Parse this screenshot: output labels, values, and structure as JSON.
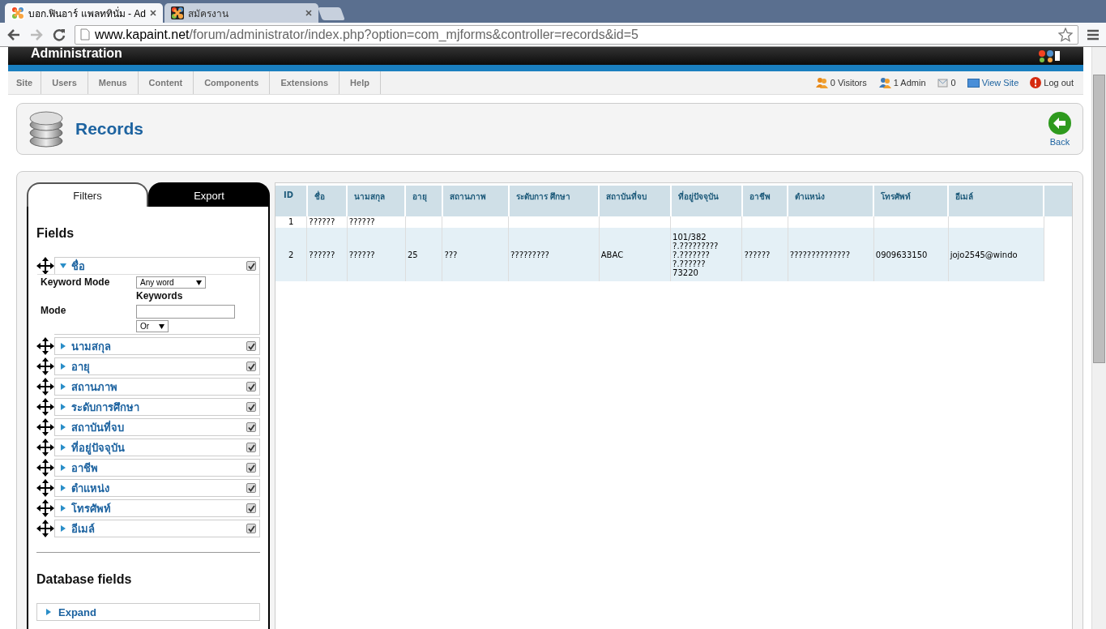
{
  "browser": {
    "tabs": [
      {
        "title": "บอก.ฟินอาร์ แพลททินั่ม - Ad",
        "selected": true
      },
      {
        "title": "สมัครงาน",
        "selected": false
      }
    ],
    "url": {
      "host": "www.kapaint.net",
      "path": "/forum/administrator/index.php?option=com_mjforms&controller=records&id=5"
    }
  },
  "header": {
    "title": "Administration"
  },
  "menu": [
    "Site",
    "Users",
    "Menus",
    "Content",
    "Components",
    "Extensions",
    "Help"
  ],
  "status": [
    {
      "kind": "visitors",
      "text": "0 Visitors"
    },
    {
      "kind": "admins",
      "text": "1 Admin"
    },
    {
      "kind": "messages",
      "text": "0"
    },
    {
      "kind": "view-site",
      "text": "View Site"
    },
    {
      "kind": "logout",
      "text": "Log out"
    }
  ],
  "toolbar": {
    "title": "Records",
    "back": "Back"
  },
  "filters": {
    "tabs": [
      {
        "label": "Filters",
        "selected": true
      },
      {
        "label": "Export",
        "selected": false
      }
    ],
    "fields_heading": "Fields",
    "fields": [
      {
        "label": "ชื่อ",
        "expanded": true,
        "checked": true
      },
      {
        "label": "นามสกุล",
        "expanded": false,
        "checked": true
      },
      {
        "label": "อายุ",
        "expanded": false,
        "checked": true
      },
      {
        "label": "สถานภาพ",
        "expanded": false,
        "checked": true
      },
      {
        "label": "ระดับการศึกษา",
        "expanded": false,
        "checked": true
      },
      {
        "label": "สถาบันที่จบ",
        "expanded": false,
        "checked": true
      },
      {
        "label": "ที่อยู่ปัจจุบัน",
        "expanded": false,
        "checked": true
      },
      {
        "label": "อาชีพ",
        "expanded": false,
        "checked": true
      },
      {
        "label": "ตำแหน่ง",
        "expanded": false,
        "checked": true
      },
      {
        "label": "โทรศัพท์",
        "expanded": false,
        "checked": true
      },
      {
        "label": "อีเมล์",
        "expanded": false,
        "checked": true
      }
    ],
    "detail": {
      "keyword_mode_label": "Keyword Mode",
      "keyword_mode_value": "Any word",
      "keywords_label": "Keywords",
      "mode_label": "Mode",
      "mode_value": "Or"
    },
    "db_heading": "Database fields",
    "expand": "Expand"
  },
  "table": {
    "columns": [
      "ID",
      "ชื่อ",
      "นามสกุล",
      "อายุ",
      "สถานภาพ",
      "ระดับการ ศึกษา",
      "สถาบันที่จบ",
      "ที่อยู่ปัจจุบัน",
      "อาชีพ",
      "ตำแหน่ง",
      "โทรศัพท์",
      "อีเมล์"
    ],
    "rows": [
      [
        "1",
        "??????",
        "??????",
        "",
        "",
        "",
        "",
        "",
        "",
        "",
        "",
        ""
      ],
      [
        "2",
        "??????",
        "??????",
        "25",
        "???",
        "?????????",
        "ABAC",
        "101/382\n?.?????????\n?.???????\n?.??????\n73220",
        "??????",
        "??????????????",
        "0909633150",
        "jojo2545@windo"
      ]
    ]
  }
}
